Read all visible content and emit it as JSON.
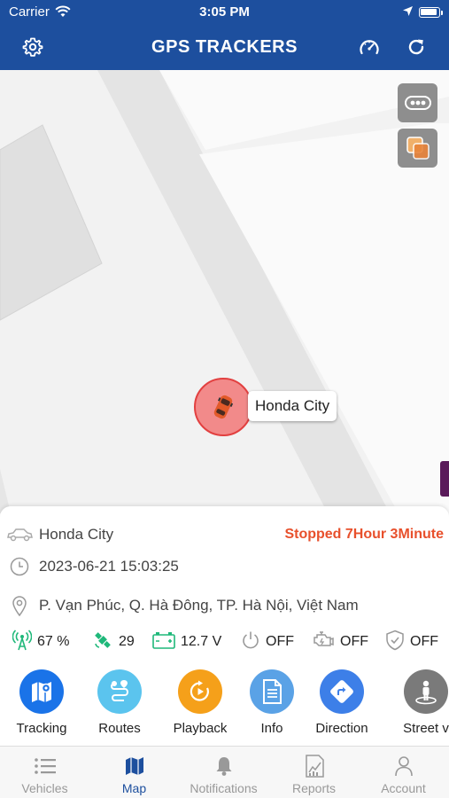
{
  "status_bar": {
    "carrier": "Carrier",
    "time": "3:05 PM"
  },
  "header": {
    "title": "GPS TRACKERS"
  },
  "map": {
    "marker_label": "Honda City"
  },
  "vehicle": {
    "name": "Honda City",
    "status": "Stopped 7Hour 3Minute",
    "datetime": "2023-06-21 15:03:25",
    "address": "P. Vạn Phúc, Q. Hà Đông, TP. Hà Nội, Việt Nam"
  },
  "sensors": [
    {
      "icon": "signal-icon",
      "value": "67 %"
    },
    {
      "icon": "satellite-icon",
      "value": "29"
    },
    {
      "icon": "battery-icon",
      "value": "12.7 V"
    },
    {
      "icon": "power-icon",
      "value": "OFF"
    },
    {
      "icon": "engine-icon",
      "value": "OFF"
    },
    {
      "icon": "shield-icon",
      "value": "OFF"
    }
  ],
  "actions": [
    {
      "label": "Tracking",
      "color": "#1a73e8"
    },
    {
      "label": "Routes",
      "color": "#5bc4ee"
    },
    {
      "label": "Playback",
      "color": "#f5a01a"
    },
    {
      "label": "Info",
      "color": "#5aa2e6"
    },
    {
      "label": "Direction",
      "color": "#3d7fe8"
    },
    {
      "label": "Street v",
      "color": "#7a7a7a"
    }
  ],
  "tabs": [
    {
      "label": "Vehicles",
      "active": false
    },
    {
      "label": "Map",
      "active": true
    },
    {
      "label": "Notifications",
      "active": false
    },
    {
      "label": "Reports",
      "active": false
    },
    {
      "label": "Account",
      "active": false
    }
  ],
  "colors": {
    "brand": "#1d4f9e",
    "status_stopped": "#e8502c",
    "sensor_green": "#1fb87a"
  }
}
